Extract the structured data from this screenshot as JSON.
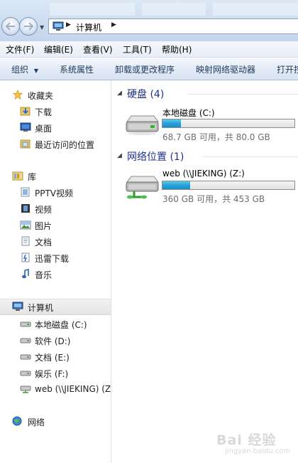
{
  "address": {
    "path": "计算机"
  },
  "menu": [
    "文件(F)",
    "编辑(E)",
    "查看(V)",
    "工具(T)",
    "帮助(H)"
  ],
  "commands": {
    "organize": "组织",
    "items": [
      "系统属性",
      "卸载或更改程序",
      "映射网络驱动器",
      "打开控"
    ]
  },
  "nav": {
    "favorites": {
      "label": "收藏夹",
      "items": [
        "下载",
        "桌面",
        "最近访问的位置"
      ]
    },
    "libraries": {
      "label": "库",
      "items": [
        "PPTV视频",
        "视频",
        "图片",
        "文档",
        "迅雷下载",
        "音乐"
      ]
    },
    "computer": {
      "label": "计算机",
      "items": [
        "本地磁盘 (C:)",
        "软件 (D:)",
        "文档 (E:)",
        "娱乐 (F:)",
        "web (\\\\JIEKING) (Z"
      ]
    },
    "network": {
      "label": "网络"
    }
  },
  "groups": [
    {
      "title": "硬盘 (4)",
      "drives": [
        {
          "name": "本地磁盘 (C:)",
          "size_text": "68.7 GB 可用，共 80.0 GB",
          "used_fraction": 0.14
        }
      ]
    },
    {
      "title": "网络位置 (1)",
      "drives": [
        {
          "name": "web (\\\\JIEKING) (Z:)",
          "size_text": "360 GB 可用，共 453 GB",
          "used_fraction": 0.21
        }
      ]
    }
  ],
  "watermark": {
    "text": "Bai 经验",
    "sub": "jingyan.baidu.com"
  },
  "colors": {
    "group_title": "#1e3287",
    "bar_fill": "#26a0da",
    "selected_bg": "#e4e4e4"
  }
}
